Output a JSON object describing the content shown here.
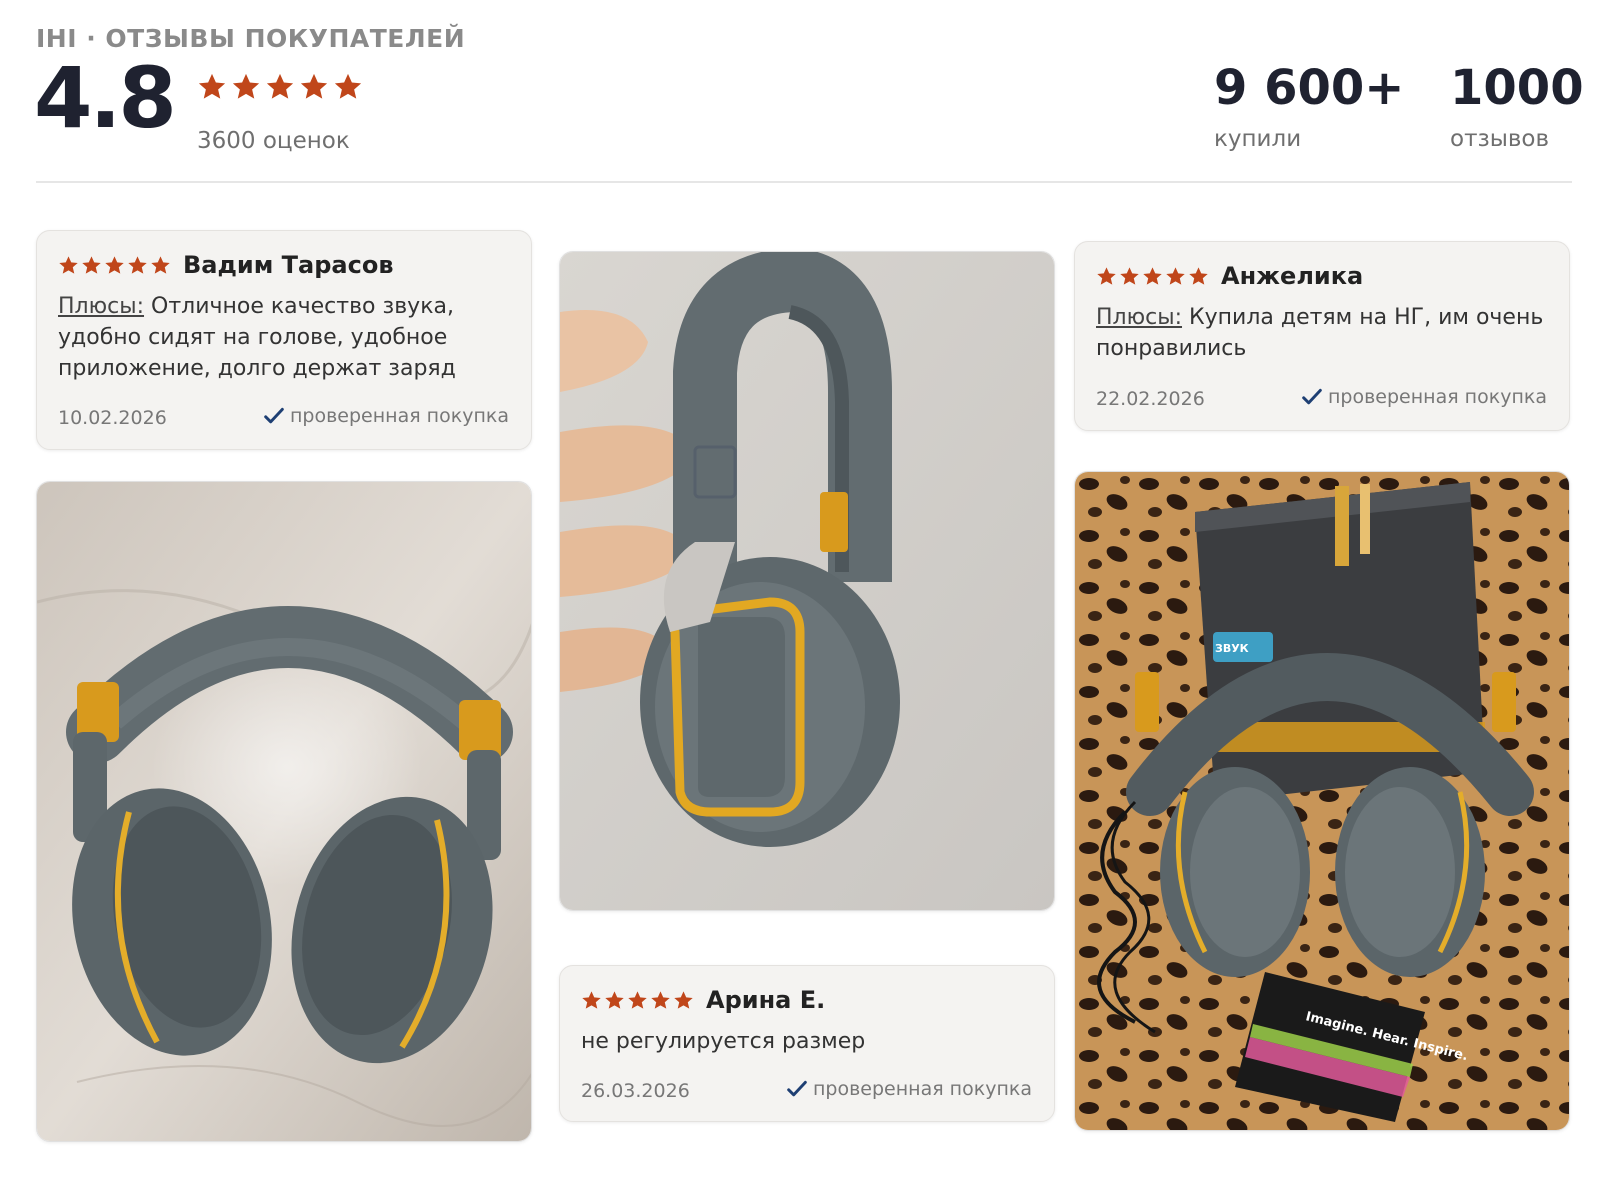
{
  "header": {
    "brand": "IHI · ОТЗЫВЫ ПОКУПАТЕЛЕЙ",
    "rating": "4.8",
    "rating_stars": 5,
    "ratings_count": "3600 оценок",
    "bought_value": "9 600+",
    "bought_label": "купили",
    "reviews_value": "1000",
    "reviews_label": "отзывов"
  },
  "colors": {
    "star": "#c0461a",
    "check": "#1e3f73",
    "headphone": "#5f6d74",
    "gold": "#d89a1d"
  },
  "reviews": [
    {
      "author": "Вадим Тарасов",
      "stars": 5,
      "plus_label": "Плюсы:",
      "text": "Отличное качество звука, удобно сидят на голове, удобное приложение, долго держат заряд",
      "date": "10.02.2026",
      "verified": "проверенная покупка"
    },
    {
      "author": "Анжелика",
      "stars": 5,
      "plus_label": "Плюсы:",
      "text": "Купила детям на НГ, им очень понравились",
      "date": "22.02.2026",
      "verified": "проверенная покупка"
    },
    {
      "author": "Арина Е.",
      "stars": 5,
      "text": "не регулируется размер",
      "date": "26.03.2026",
      "verified": "проверенная покупка"
    }
  ],
  "photos": {
    "photo1": "headphones-on-marble-photo",
    "photo2": "headphones-in-hand-photo",
    "photo3": "headphones-with-box-photo",
    "box_slogan": "Imagine. Hear. Inspire.",
    "box_label": "ЗВУК"
  }
}
